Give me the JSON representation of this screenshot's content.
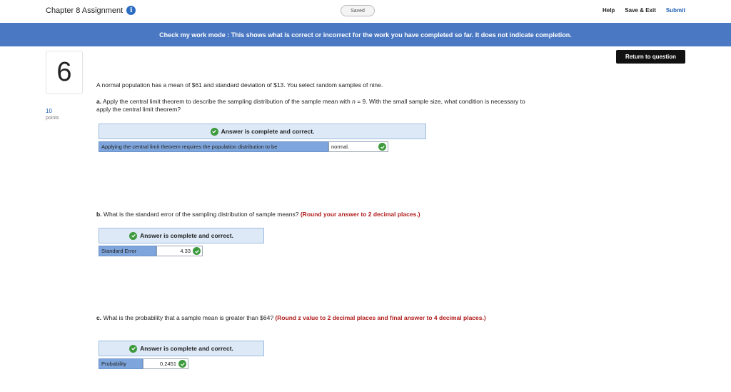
{
  "header": {
    "title": "Chapter 8 Assignment",
    "saved_label": "Saved",
    "help_label": "Help",
    "save_exit_label": "Save & Exit",
    "submit_label": "Submit"
  },
  "banner": {
    "text": "Check my work mode : This shows what is correct or incorrect for the work you have completed so far. It does not indicate completion."
  },
  "return_button": "Return to question",
  "question": {
    "number": "6",
    "points": "10",
    "points_label": "points",
    "stem": "A normal population has a mean of $61 and standard deviation of $13. You select random samples of nine."
  },
  "part_a": {
    "prefix": "a.",
    "text_before_n": " Apply the central limit theorem to describe the sampling distribution of the sample mean with ",
    "n_symbol": "n",
    "text_after_n": " = 9. With the small sample size, what condition is necessary to apply the central limit theorem?",
    "status": "Answer is complete and correct.",
    "label": "Applying the central limit theorem requires the population distribution to be",
    "value": "normal."
  },
  "part_b": {
    "prefix": "b.",
    "text": " What is the standard error of the sampling distribution of sample means? ",
    "instruction": "(Round your answer to 2 decimal places.)",
    "status": "Answer is complete and correct.",
    "label": "Standard Error",
    "value": "4.33"
  },
  "part_c": {
    "prefix": "c.",
    "text": " What is the probability that a sample mean is greater than $64? ",
    "instruction": "(Round z value to 2 decimal places and final answer to 4 decimal places.)",
    "status": "Answer is complete and correct.",
    "label": "Probability",
    "value": "0.2451"
  },
  "icons": {
    "info": "info-icon",
    "check": "check-circle-icon"
  },
  "colors": {
    "banner": "#4a78c2",
    "correct": "#3d9a3d",
    "instruction": "#b01c1c",
    "link": "#1d5fb4"
  }
}
